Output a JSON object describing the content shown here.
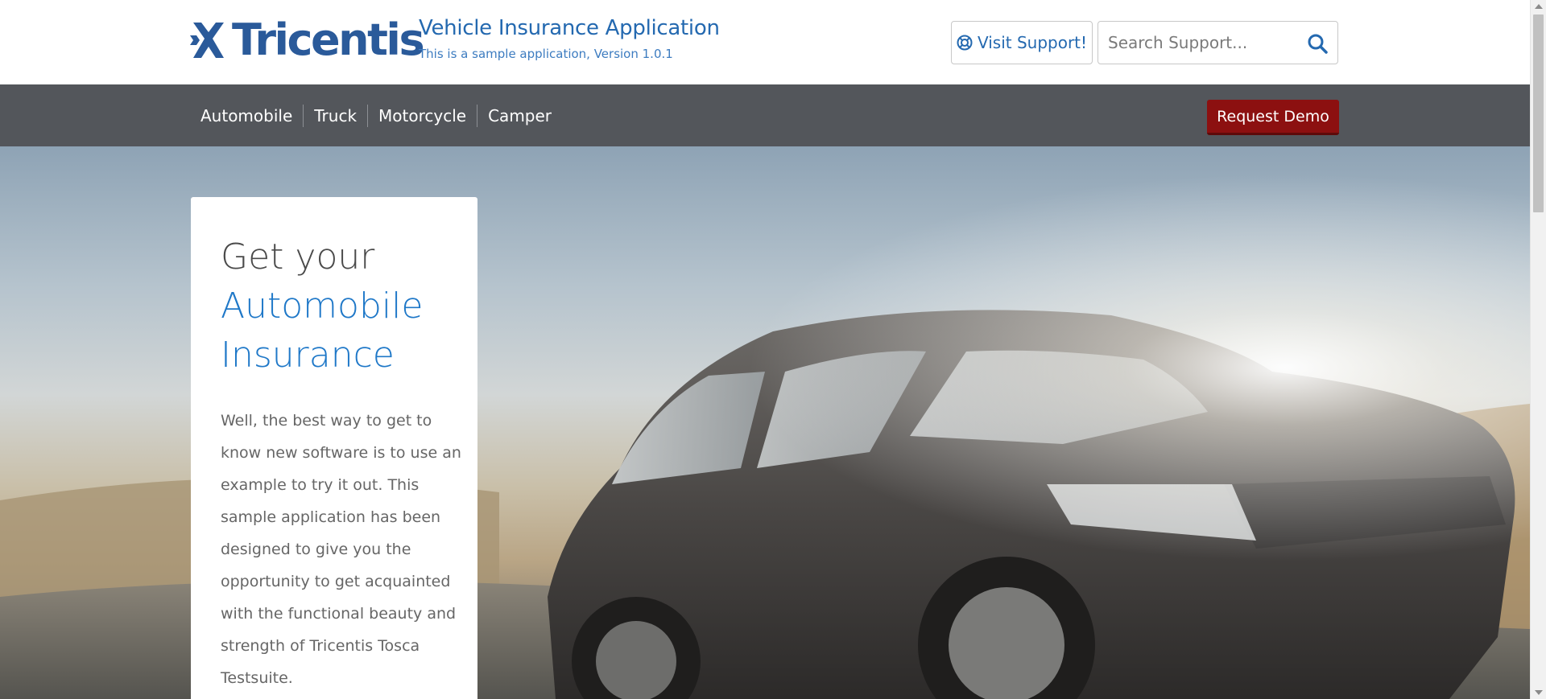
{
  "header": {
    "logo_text": "Tricentis",
    "app_title": "Vehicle Insurance Application",
    "app_subtitle": "This is a sample application, Version 1.0.1",
    "support_button_label": "Visit Support!",
    "search_placeholder": "Search Support..."
  },
  "nav": {
    "items": [
      {
        "label": "Automobile"
      },
      {
        "label": "Truck"
      },
      {
        "label": "Motorcycle"
      },
      {
        "label": "Camper"
      }
    ],
    "demo_button_label": "Request Demo"
  },
  "hero": {
    "title_line1": "Get your",
    "title_line2": "Automobile",
    "title_line3": "Insurance",
    "description": "Well, the best way to get to know new software is to use an example to try it out. This sample application has been designed to give you the opportunity to get acquainted with the functional beauty and strength of Tricentis Tosca Testsuite.",
    "image": "car-photo"
  },
  "colors": {
    "brand_blue": "#2469b0",
    "nav_bg": "#53565b",
    "demo_button": "#8c1010",
    "title_accent": "#1f78c8"
  },
  "icons": {
    "support": "lifebuoy-icon",
    "search": "search-icon"
  }
}
